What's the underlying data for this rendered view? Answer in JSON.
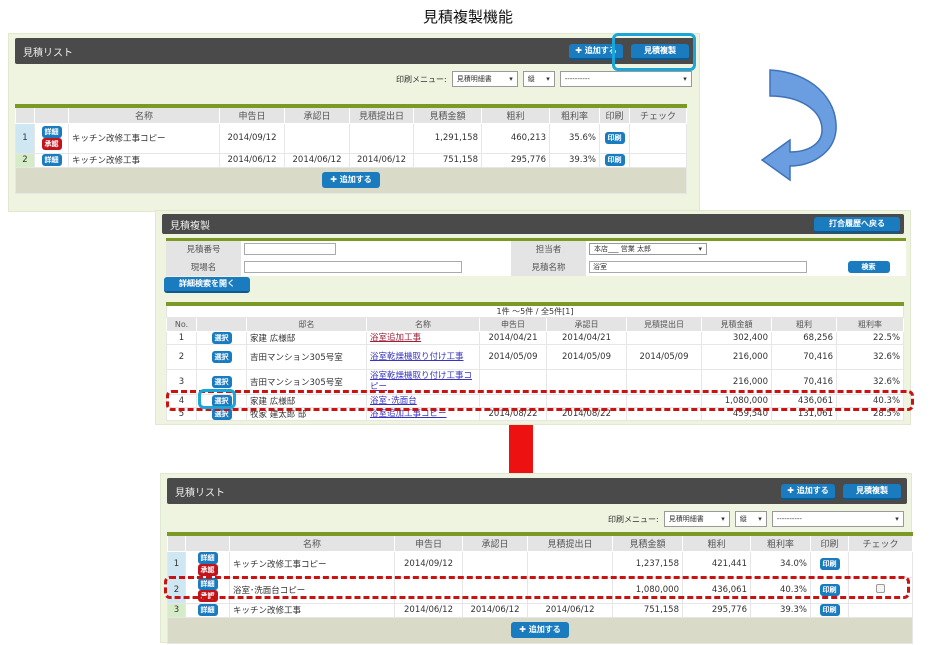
{
  "title": "見積複製機能",
  "colors": {
    "accent": "#1a7bbf",
    "approve": "#c0141c",
    "header": "#4a4a4a",
    "table_rule": "#7a9a25",
    "highlight": "#1aa6d8",
    "dashed": "#cc1111",
    "curved_arrow": "#5b8fd6",
    "down_arrow": "#ee1111"
  },
  "icons": {
    "add": "plus-icon",
    "curved_arrow": "curved-arrow-icon",
    "down_arrow": "down-arrow-icon"
  },
  "list_before": {
    "header": "見積リスト",
    "add_label": "追加する",
    "copy_label": "見積複製",
    "print_menu_label": "印刷メニュー:",
    "print_doc": "見積明細書",
    "orientation": "縦",
    "extra": "----------",
    "columns": [
      "",
      "",
      "名称",
      "申告日",
      "承認日",
      "見積提出日",
      "見積金額",
      "粗利",
      "粗利率",
      "印刷",
      "チェック"
    ],
    "rows": [
      {
        "no": "1",
        "detail": "詳細",
        "approve": "承認",
        "name": "キッチン改修工事コピー",
        "filed": "2014/09/12",
        "approved": "",
        "submitted": "",
        "amount": "1,291,158",
        "profit": "460,213",
        "rate": "35.6%",
        "print": "印刷",
        "check": false
      },
      {
        "no": "2",
        "detail": "詳細",
        "approve": "",
        "name": "キッチン改修工事",
        "filed": "2014/06/12",
        "approved": "2014/06/12",
        "submitted": "2014/06/12",
        "amount": "751,158",
        "profit": "295,776",
        "rate": "39.3%",
        "print": "印刷",
        "check": false
      }
    ],
    "footer_add": "追加する"
  },
  "copy": {
    "header": "見積複製",
    "back_label": "打合履歴へ戻る",
    "search": {
      "number_label": "見積番号",
      "number_value": "",
      "site_label": "現場名",
      "site_value": "",
      "staff_label": "担当者",
      "staff_value": "本店___ 営業 太郎",
      "est_name_label": "見積名称",
      "est_name_value": "浴室",
      "search_label": "検索"
    },
    "advanced_label": "詳細検索を開く",
    "pager": "1件 ～5件 / 全5件[1]",
    "columns": [
      "No.",
      "",
      "邸名",
      "名称",
      "申告日",
      "承認日",
      "見積提出日",
      "見積金額",
      "粗利",
      "粗利率"
    ],
    "rows": [
      {
        "no": "1",
        "select": "選択",
        "house": "家建 広様邸",
        "name": "浴室追加工事",
        "filed": "2014/04/21",
        "approved": "2014/04/21",
        "submitted": "",
        "amount": "302,400",
        "profit": "68,256",
        "rate": "22.5%"
      },
      {
        "no": "2",
        "select": "選択",
        "house": "吉田マンション305号室",
        "name": "浴室乾燥機取り付け工事",
        "filed": "2014/05/09",
        "approved": "2014/05/09",
        "submitted": "2014/05/09",
        "amount": "216,000",
        "profit": "70,416",
        "rate": "32.6%"
      },
      {
        "no": "3",
        "select": "選択",
        "house": "吉田マンション305号室",
        "name": "浴室乾燥機取り付け工事コピー",
        "filed": "",
        "approved": "",
        "submitted": "",
        "amount": "216,000",
        "profit": "70,416",
        "rate": "32.6%"
      },
      {
        "no": "4",
        "select": "選択",
        "house": "家建 広様邸",
        "name": "浴室･洗面台",
        "filed": "",
        "approved": "",
        "submitted": "",
        "amount": "1,080,000",
        "profit": "436,061",
        "rate": "40.3%"
      },
      {
        "no": "5",
        "select": "選択",
        "house": "牧家 建太郎 邸",
        "name": "浴室追加工事コピー",
        "filed": "2014/08/22",
        "approved": "2014/08/22",
        "submitted": "",
        "amount": "459,540",
        "profit": "131,061",
        "rate": "28.5%"
      }
    ]
  },
  "list_after": {
    "header": "見積リスト",
    "add_label": "追加する",
    "copy_label": "見積複製",
    "print_menu_label": "印刷メニュー:",
    "print_doc": "見積明細書",
    "orientation": "縦",
    "extra": "----------",
    "columns": [
      "",
      "",
      "名称",
      "申告日",
      "承認日",
      "見積提出日",
      "見積金額",
      "粗利",
      "粗利率",
      "印刷",
      "チェック"
    ],
    "rows": [
      {
        "no": "1",
        "detail": "詳細",
        "approve": "承認",
        "name": "キッチン改修工事コピー",
        "filed": "2014/09/12",
        "approved": "",
        "submitted": "",
        "amount": "1,237,158",
        "profit": "421,441",
        "rate": "34.0%",
        "print": "印刷",
        "check": false
      },
      {
        "no": "2",
        "detail": "詳細",
        "approve": "承認",
        "name": "浴室･洗面台コピー",
        "filed": "",
        "approved": "",
        "submitted": "",
        "amount": "1,080,000",
        "profit": "436,061",
        "rate": "40.3%",
        "print": "印刷",
        "check": true
      },
      {
        "no": "3",
        "detail": "詳細",
        "approve": "",
        "name": "キッチン改修工事",
        "filed": "2014/06/12",
        "approved": "2014/06/12",
        "submitted": "2014/06/12",
        "amount": "751,158",
        "profit": "295,776",
        "rate": "39.3%",
        "print": "印刷",
        "check": false
      }
    ],
    "footer_add": "追加する"
  }
}
